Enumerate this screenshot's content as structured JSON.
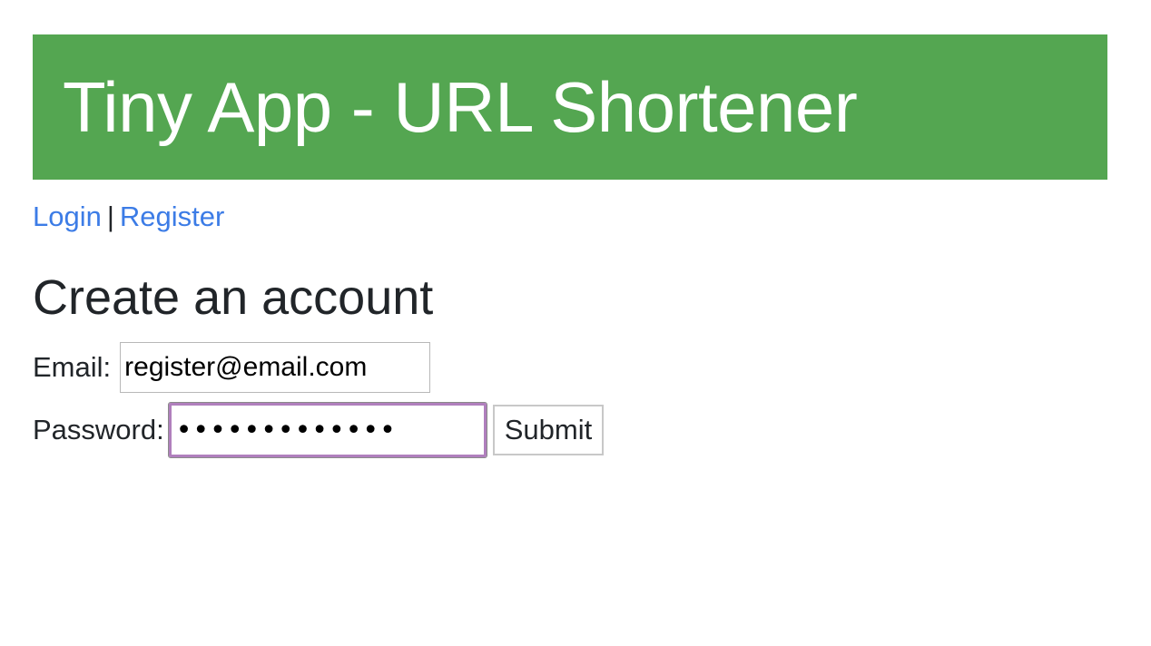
{
  "header": {
    "title": "Tiny App - URL Shortener",
    "background_color": "#54a651"
  },
  "nav": {
    "login_label": "Login",
    "separator": "|",
    "register_label": "Register",
    "link_color": "#3c7ce6"
  },
  "form": {
    "heading": "Create an account",
    "email_label": "Email:",
    "email_value": "register@email.com",
    "password_label": "Password:",
    "password_value": "•••••••••••••",
    "submit_label": "Submit",
    "focus_color": "#b07fbd"
  }
}
